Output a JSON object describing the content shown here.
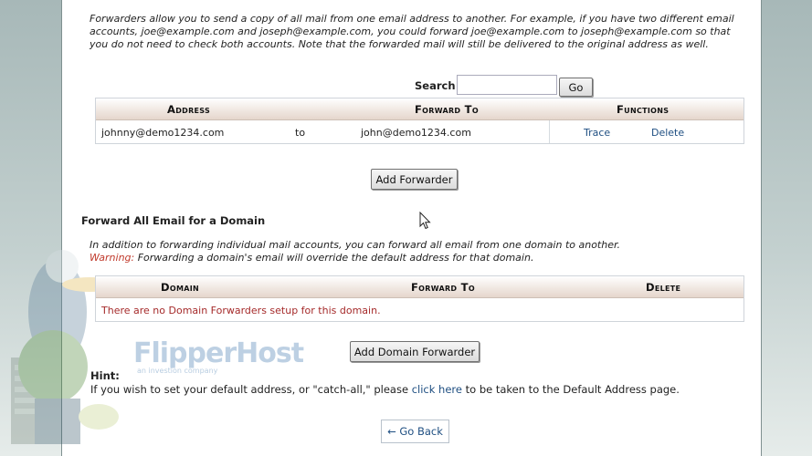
{
  "forwarders": {
    "intro": "Forwarders allow you to send a copy of all mail from one email address to another. For example, if you have two different email accounts, joe@example.com and joseph@example.com, you could forward joe@example.com to joseph@example.com so that you do not need to check both accounts. Note that the forwarded mail will still be delivered to the original address as well.",
    "search_label": "Search",
    "search_value": "",
    "go_label": "Go",
    "columns": {
      "address": "Address",
      "forward_to": "Forward To",
      "functions": "Functions"
    },
    "rows": [
      {
        "address": "johnny@demo1234.com",
        "to": "to",
        "forward_to": "john@demo1234.com",
        "trace": "Trace",
        "delete": "Delete"
      }
    ],
    "add_button": "Add Forwarder"
  },
  "domain_forwarding": {
    "title": "Forward All Email for a Domain",
    "intro": "In addition to forwarding individual mail accounts, you can forward all email from one domain to another.",
    "warning_label": "Warning:",
    "warning_text": " Forwarding a domain's email will override the default address for that domain.",
    "columns": {
      "domain": "Domain",
      "forward_to": "Forward To",
      "delete": "Delete"
    },
    "empty_message": "There are no Domain Forwarders setup for this domain.",
    "add_button": "Add Domain Forwarder"
  },
  "hint": {
    "title": "Hint:",
    "text_before": "If you wish to set your default address, or \"catch-all,\" please ",
    "link": "click here",
    "text_after": " to be taken to the Default Address page."
  },
  "back_button": "← Go Back",
  "watermark": {
    "brand": "FlipperHost",
    "tagline": "an investion company"
  },
  "colors": {
    "link": "#1f4f82",
    "warning": "#c0392b",
    "empty_message": "#a52a2a",
    "header_gradient_end": "#e5d6cc"
  }
}
